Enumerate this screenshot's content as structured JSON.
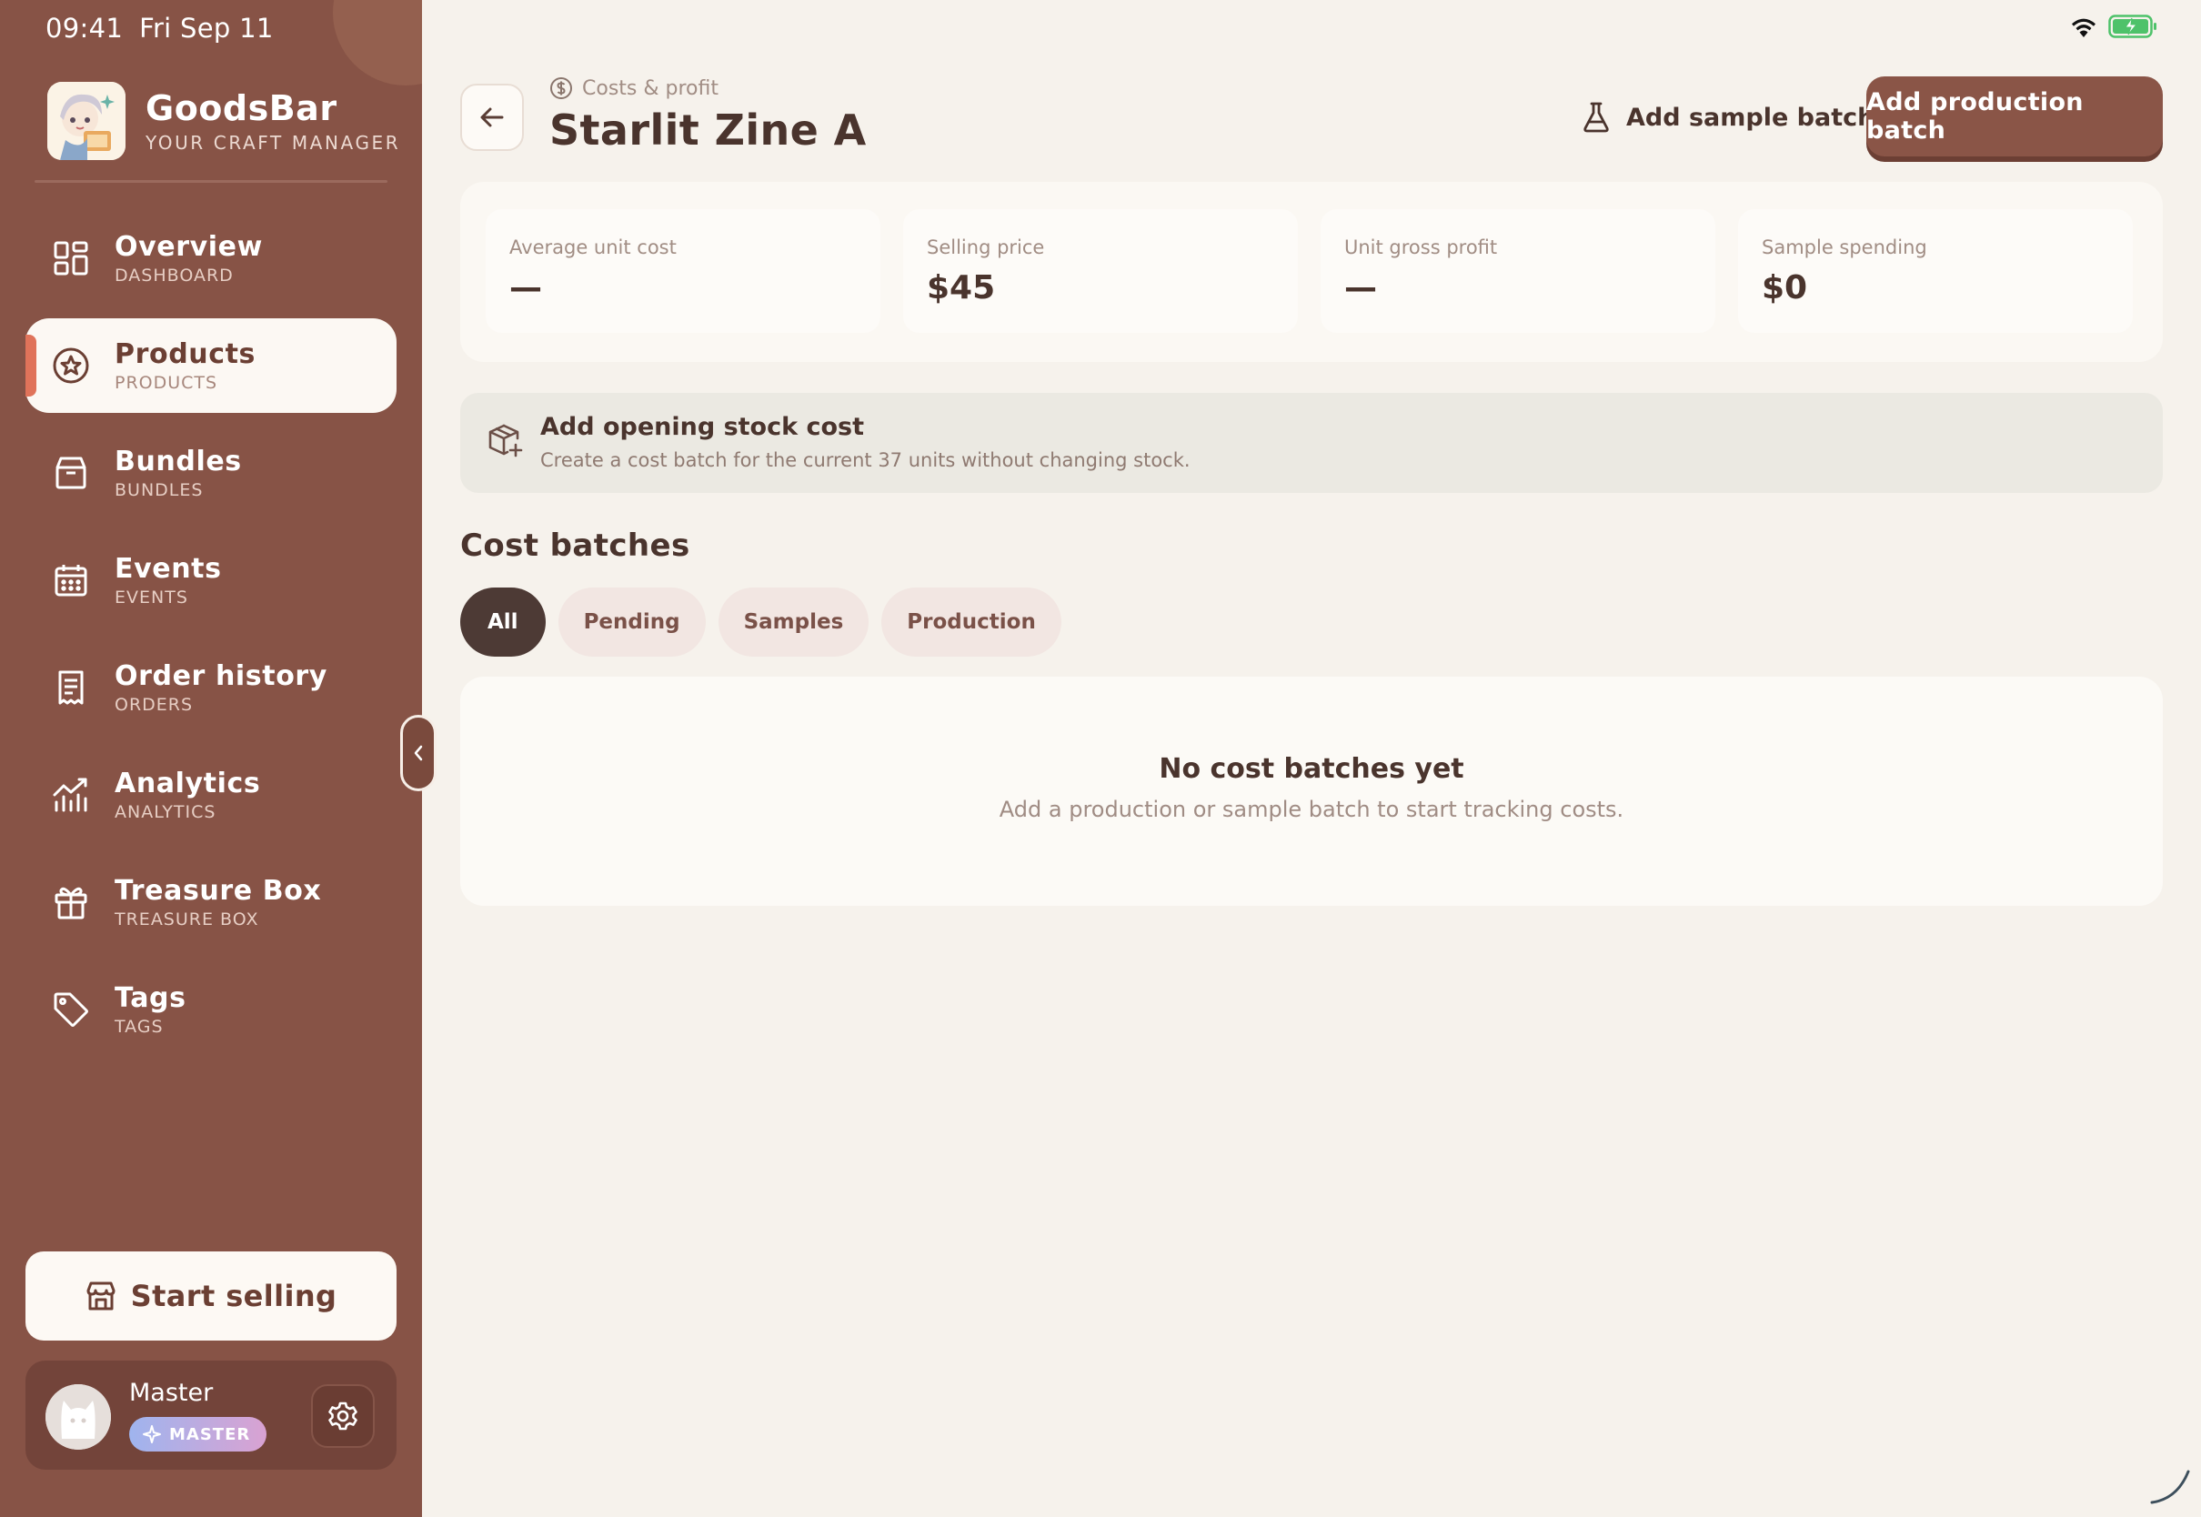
{
  "status_bar": {
    "time": "09:41",
    "date": "Fri Sep 11"
  },
  "brand": {
    "name": "GoodsBar",
    "tagline": "YOUR CRAFT MANAGER"
  },
  "nav": [
    {
      "label": "Overview",
      "sub": "DASHBOARD",
      "icon": "grid-icon",
      "active": false
    },
    {
      "label": "Products",
      "sub": "PRODUCTS",
      "icon": "star-badge-icon",
      "active": true
    },
    {
      "label": "Bundles",
      "sub": "BUNDLES",
      "icon": "box-icon",
      "active": false
    },
    {
      "label": "Events",
      "sub": "EVENTS",
      "icon": "calendar-icon",
      "active": false
    },
    {
      "label": "Order history",
      "sub": "ORDERS",
      "icon": "receipt-icon",
      "active": false
    },
    {
      "label": "Analytics",
      "sub": "ANALYTICS",
      "icon": "chart-icon",
      "active": false
    },
    {
      "label": "Treasure Box",
      "sub": "TREASURE BOX",
      "icon": "gift-icon",
      "active": false
    },
    {
      "label": "Tags",
      "sub": "TAGS",
      "icon": "tag-icon",
      "active": false
    }
  ],
  "start_selling": "Start selling",
  "user": {
    "name": "Master",
    "badge": "MASTER"
  },
  "header": {
    "breadcrumb": "Costs & profit",
    "title": "Starlit Zine A",
    "sample_button": "Add sample batch",
    "production_button": "Add production batch"
  },
  "stats": [
    {
      "label": "Average unit cost",
      "value": "—"
    },
    {
      "label": "Selling price",
      "value": "$45"
    },
    {
      "label": "Unit gross profit",
      "value": "—"
    },
    {
      "label": "Sample spending",
      "value": "$0"
    }
  ],
  "opening": {
    "title": "Add opening stock cost",
    "description": "Create a cost batch for the current 37 units without changing stock."
  },
  "batches": {
    "title": "Cost batches",
    "filters": [
      {
        "label": "All",
        "active": true
      },
      {
        "label": "Pending",
        "active": false
      },
      {
        "label": "Samples",
        "active": false
      },
      {
        "label": "Production",
        "active": false
      }
    ],
    "empty_title": "No cost batches yet",
    "empty_description": "Add a production or sample batch to start tracking costs."
  },
  "colors": {
    "sidebar": "#875346",
    "accent": "#e0735a",
    "primary_button": "#8a5547",
    "background": "#f6f2ec"
  }
}
